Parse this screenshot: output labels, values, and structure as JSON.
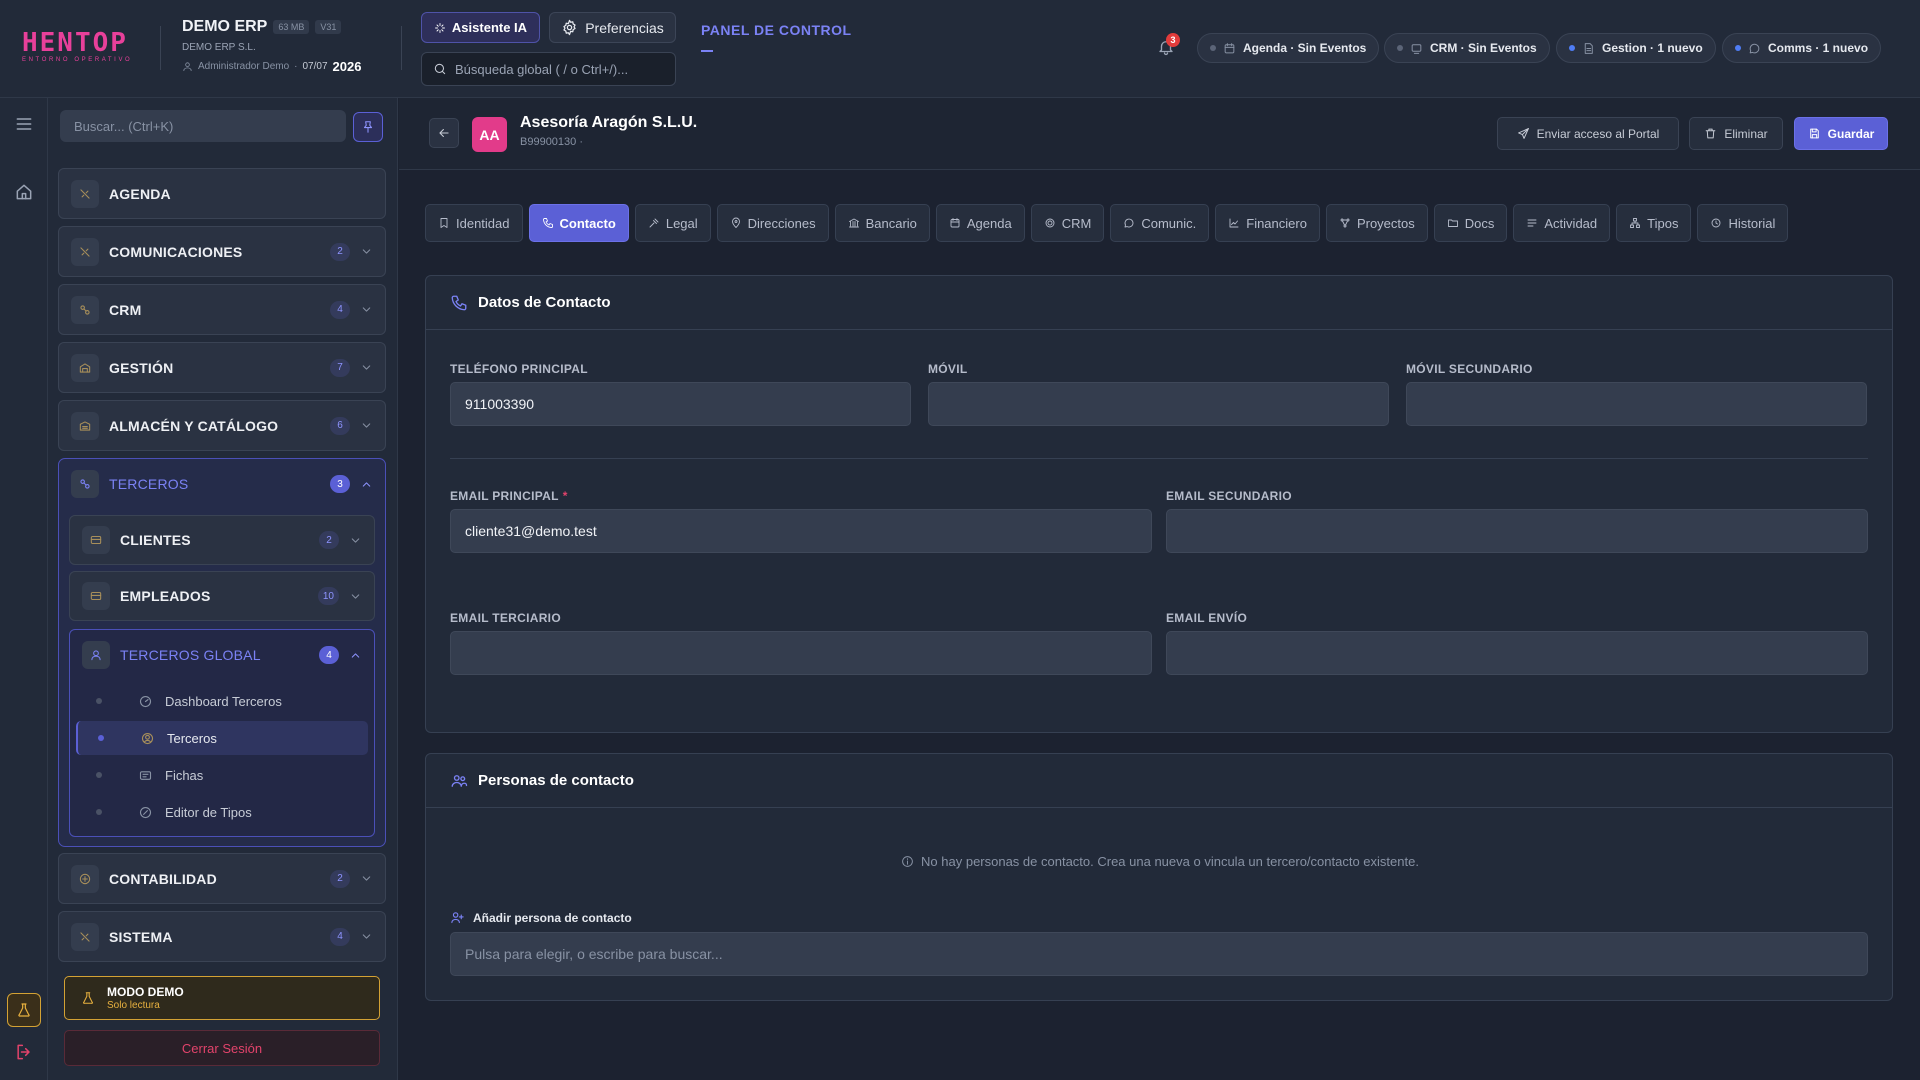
{
  "brand": {
    "logo_text": "HENTOP",
    "logo_subtitle": "ENTORNO OPERATIVO",
    "logo_color": "#e8409a"
  },
  "company": {
    "name": "DEMO ERP",
    "size_badge": "63 MB",
    "version_badge": "V31",
    "legal_name": "DEMO ERP S.L.",
    "user": "Administrador Demo",
    "date": "07/07",
    "year": "2026"
  },
  "header": {
    "ai_button": "Asistente IA",
    "preferences_button": "Preferencias",
    "search_placeholder": "Búsqueda global ( / o Ctrl+/)...",
    "panel_title": "PANEL DE CONTROL",
    "notifications_count": "3",
    "status_pills": [
      {
        "label": "Agenda · Sin Eventos",
        "icon": "calendar-icon"
      },
      {
        "label": "CRM · Sin Eventos",
        "icon": "crm-icon"
      },
      {
        "label": "Gestion · 1 nuevo",
        "icon": "document-icon"
      },
      {
        "label": "Comms · 1 nuevo",
        "icon": "chat-icon"
      }
    ]
  },
  "sidebar": {
    "search_placeholder": "Buscar... (Ctrl+K)",
    "items": [
      {
        "label": "AGENDA",
        "count": ""
      },
      {
        "label": "COMUNICACIONES",
        "count": "2"
      },
      {
        "label": "CRM",
        "count": "4"
      },
      {
        "label": "GESTIÓN",
        "count": "7"
      },
      {
        "label": "ALMACÉN Y CATÁLOGO",
        "count": "6"
      }
    ],
    "open_group": {
      "label": "TERCEROS",
      "count": "3",
      "children": [
        {
          "label": "CLIENTES",
          "count": "2"
        },
        {
          "label": "EMPLEADOS",
          "count": "10"
        }
      ],
      "open_child": {
        "label": "TERCEROS GLOBAL",
        "count": "4",
        "leaves": [
          {
            "label": "Dashboard Terceros"
          },
          {
            "label": "Terceros"
          },
          {
            "label": "Fichas"
          },
          {
            "label": "Editor de Tipos"
          }
        ]
      }
    },
    "items_after": [
      {
        "label": "CONTABILIDAD",
        "count": "2"
      },
      {
        "label": "SISTEMA",
        "count": "4"
      }
    ],
    "demo_title": "MODO DEMO",
    "demo_subtitle": "Solo lectura",
    "logout_label": "Cerrar Sesión"
  },
  "record": {
    "avatar_initials": "AA",
    "name": "Asesoría Aragón S.L.U.",
    "identifier": "B99900130 ·",
    "actions": {
      "portal": "Enviar acceso al Portal",
      "delete": "Eliminar",
      "save": "Guardar"
    }
  },
  "tabs": [
    {
      "label": "Identidad",
      "icon": "bookmark-icon"
    },
    {
      "label": "Contacto",
      "icon": "phone-icon"
    },
    {
      "label": "Legal",
      "icon": "gavel-icon"
    },
    {
      "label": "Direcciones",
      "icon": "pin-icon"
    },
    {
      "label": "Bancario",
      "icon": "bank-icon"
    },
    {
      "label": "Agenda",
      "icon": "calendar-icon"
    },
    {
      "label": "CRM",
      "icon": "target-icon"
    },
    {
      "label": "Comunic.",
      "icon": "chat-icon"
    },
    {
      "label": "Financiero",
      "icon": "chart-icon"
    },
    {
      "label": "Proyectos",
      "icon": "nodes-icon"
    },
    {
      "label": "Docs",
      "icon": "folder-icon"
    },
    {
      "label": "Actividad",
      "icon": "list-icon"
    },
    {
      "label": "Tipos",
      "icon": "hierarchy-icon"
    },
    {
      "label": "Historial",
      "icon": "clock-icon"
    }
  ],
  "active_tab": "Contacto",
  "contact_card": {
    "title": "Datos de Contacto",
    "phone_label": "TELÉFONO PRINCIPAL",
    "phone_value": "911003390",
    "mobile_label": "MÓVIL",
    "mobile_value": "",
    "mobile2_label": "MÓVIL SECUNDARIO",
    "mobile2_value": "",
    "email_label": "EMAIL PRINCIPAL",
    "email_required": "*",
    "email_value": "cliente31@demo.test",
    "email2_label": "EMAIL SECUNDARIO",
    "email2_value": "",
    "email3_label": "EMAIL TERCIARIO",
    "email3_value": "",
    "email_send_label": "EMAIL ENVÍO",
    "email_send_value": ""
  },
  "persons_card": {
    "title": "Personas de contacto",
    "empty_message": "No hay personas de contacto. Crea una nueva o vincula un tercero/contacto existente.",
    "add_label": "Añadir persona de contacto",
    "add_placeholder": "Pulsa para elegir, o escribe para buscar..."
  },
  "colors": {
    "accent": "#5b60d6",
    "accent_text": "#7b82f5",
    "danger": "#e2436b",
    "warning": "#d4a234"
  }
}
